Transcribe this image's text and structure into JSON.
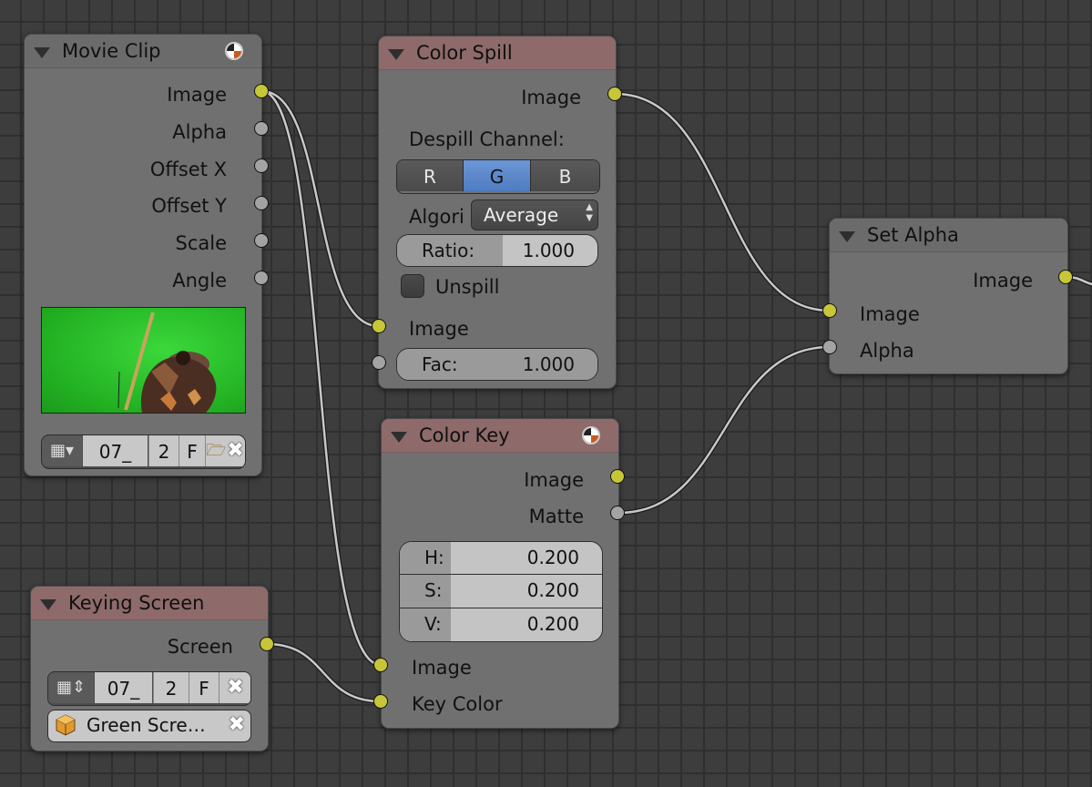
{
  "colors": {
    "background": "#3d3d3d",
    "node": "#707070",
    "socket_image": "#c6c638",
    "socket_value": "#a3a3a3",
    "selected": "#5b87c9",
    "wire": "#c8c8c8"
  },
  "movie_clip": {
    "title": "Movie Clip",
    "outputs": [
      "Image",
      "Alpha",
      "Offset X",
      "Offset Y",
      "Scale",
      "Angle"
    ],
    "clip_name": "07_",
    "users": "2",
    "fake_user": "F"
  },
  "color_spill": {
    "title": "Color Spill",
    "output_image": "Image",
    "despill_label": "Despill Channel:",
    "channels": [
      "R",
      "G",
      "B"
    ],
    "selected_channel": "G",
    "algorithm_label": "Algori",
    "algorithm_value": "Average",
    "ratio_label": "Ratio:",
    "ratio_value": "1.000",
    "unspill_label": "Unspill",
    "input_image": "Image",
    "fac_label": "Fac:",
    "fac_value": "1.000"
  },
  "set_alpha": {
    "title": "Set Alpha",
    "output_image": "Image",
    "input_image": "Image",
    "input_alpha": "Alpha"
  },
  "color_key": {
    "title": "Color Key",
    "outputs": [
      "Image",
      "Matte"
    ],
    "h_label": "H:",
    "h_value": "0.200",
    "s_label": "S:",
    "s_value": "0.200",
    "v_label": "V:",
    "v_value": "0.200",
    "inputs": [
      "Image",
      "Key Color"
    ]
  },
  "keying_screen": {
    "title": "Keying Screen",
    "output": "Screen",
    "clip_name": "07_",
    "users": "2",
    "fake_user": "F",
    "tracking_object": "Green Scre…"
  }
}
